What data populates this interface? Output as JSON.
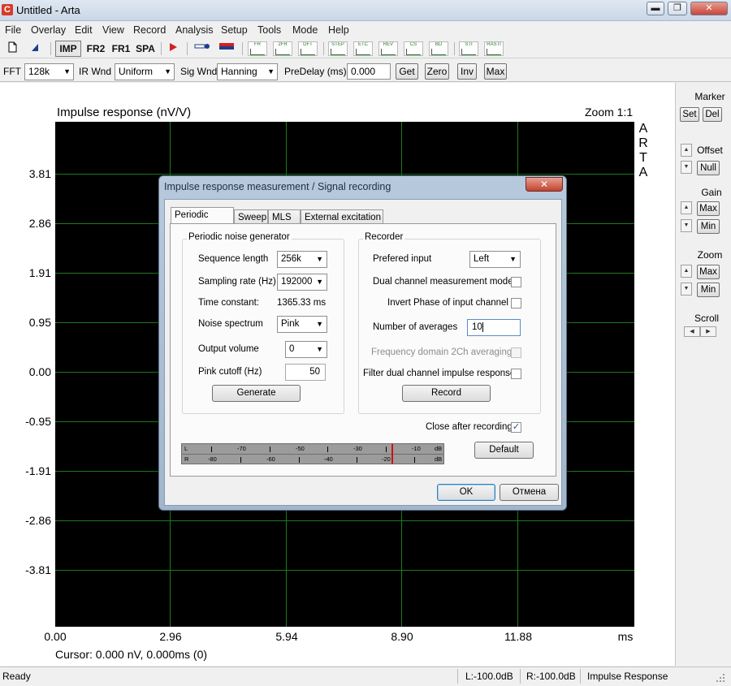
{
  "window": {
    "title": "Untitled - Arta",
    "icon_letter": "C",
    "min_label": "▬",
    "max_label": "❐",
    "close_label": "✕"
  },
  "menu": [
    "File",
    "Overlay",
    "Edit",
    "View",
    "Record",
    "Analysis",
    "Setup",
    "Tools",
    "Mode",
    "Help"
  ],
  "toolbar": {
    "imp": "IMP",
    "fr2": "FR2",
    "fr1": "FR1",
    "spa": "SPA",
    "mini_buttons": [
      "FR",
      "2FR",
      "DFT",
      "STEP",
      "ETC",
      "REV",
      "CS",
      "BD",
      "STI",
      "RASTI"
    ]
  },
  "params": {
    "fft_label": "FFT",
    "fft_value": "128k",
    "ir_wnd_label": "IR Wnd",
    "ir_wnd_value": "Uniform",
    "sig_wnd_label": "Sig Wnd",
    "sig_wnd_value": "Hanning",
    "predelay_label": "PreDelay (ms)",
    "predelay_value": "0.000",
    "get": "Get",
    "zero": "Zero",
    "inv": "Inv",
    "max": "Max"
  },
  "graph": {
    "title": "Impulse response (nV/V)",
    "zoom": "Zoom 1:1",
    "arta_letters": [
      "A",
      "R",
      "T",
      "A"
    ],
    "y_ticks": [
      "3.81",
      "2.86",
      "1.91",
      "0.95",
      "0.00",
      "-0.95",
      "-1.91",
      "-2.86",
      "-3.81"
    ],
    "x_ticks": [
      "0.00",
      "2.96",
      "5.94",
      "8.90",
      "11.88"
    ],
    "x_unit": "ms",
    "cursor": "Cursor: 0.000 nV, 0.000ms (0)",
    "colors": {
      "background": "#000000",
      "grid": "#1f7a1f"
    }
  },
  "right_panel": {
    "marker": "Marker",
    "set": "Set",
    "del": "Del",
    "offset": "Offset",
    "null": "Null",
    "gain": "Gain",
    "gain_max": "Max",
    "gain_min": "Min",
    "zoom": "Zoom",
    "zoom_max": "Max",
    "zoom_min": "Min",
    "scroll": "Scroll"
  },
  "status": {
    "ready": "Ready",
    "left": "L:-100.0dB",
    "right": "R:-100.0dB",
    "mode": "Impulse Response"
  },
  "dialog": {
    "title": "Impulse response measurement / Signal recording",
    "tabs": [
      "Periodic Noise",
      "Sweep",
      "MLS",
      "External excitation"
    ],
    "generator": {
      "group": "Periodic noise generator",
      "seq_length_label": "Sequence length",
      "seq_length_value": "256k",
      "sampling_rate_label": "Sampling rate (Hz)",
      "sampling_rate_value": "192000",
      "time_constant_label": "Time constant:",
      "time_constant_value": "1365.33 ms",
      "noise_spectrum_label": "Noise spectrum",
      "noise_spectrum_value": "Pink",
      "output_volume_label": "Output volume",
      "output_volume_value": "0",
      "pink_cutoff_label": "Pink cutoff (Hz)",
      "pink_cutoff_value": "50",
      "generate": "Generate"
    },
    "recorder": {
      "group": "Recorder",
      "prefered_input_label": "Prefered input",
      "prefered_input_value": "Left",
      "dual_channel_label": "Dual channel measurement mode",
      "invert_phase_label": "Invert Phase of input channel",
      "averages_label": "Number of averages",
      "averages_value": "10",
      "freq_domain_label": "Frequency domain 2Ch averaging",
      "filter_dual_label": "Filter dual channel impulse response",
      "record": "Record"
    },
    "close_after_label": "Close after recording",
    "close_after_mark": "✓",
    "default": "Default",
    "ok": "OK",
    "cancel": "Отмена",
    "meter": {
      "l_label": "L",
      "r_label": "R",
      "top_ticks": [
        "-70",
        "-50",
        "-30",
        "-10",
        "dB"
      ],
      "bottom_ticks": [
        "-80",
        "-60",
        "-40",
        "-20",
        "dB"
      ]
    }
  }
}
